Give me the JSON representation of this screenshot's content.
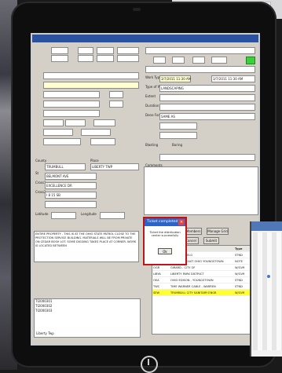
{
  "bg_left": {
    "labels": [
      "x",
      "k",
      "c",
      "e"
    ]
  },
  "tablet": {
    "name": "tablet"
  },
  "app": {
    "header_labels": [
      "Sold To",
      "Phone",
      "Street",
      "Apt",
      "City",
      "State",
      "Zip",
      "Email",
      "Phone",
      "Ext",
      "County",
      "Place",
      "Latitude",
      "Longitude"
    ],
    "header_values": {
      "phone_left": "",
      "county": "TRUMBULL",
      "place": "LIBERTY TWP"
    },
    "address": {
      "label": "St",
      "value": "BELMONT AVE"
    },
    "cross1": {
      "label": "Cross1",
      "value": "EXCELLENCE DR"
    },
    "cross2": {
      "label": "Cross2",
      "value": "I 8 15 SB"
    },
    "right_labels": [
      "Work Type",
      "Type of Work",
      "Extent",
      "Duration",
      "Done For",
      "Blasting",
      "Boring",
      "Work Type",
      "Comments"
    ],
    "right_values": {
      "work_type": "LANDSCAPING",
      "done_for": "SAME AS",
      "start_date": "3/7/2011 11:30 AM",
      "start_date2": "3/7/2011 11:30 AM"
    },
    "notes_text": "ENTIRE PROPERTY - THIS IS AT THE OHIO STATE PATROL CLOSE TO THE PROTECTION SERVICE BUILDING. MATERIALS WILL BE FROM PRIVATE ON CEDAR BOSH LOT. SOME DIGGING TAKES PLACE AT CORNER. WORK IS LOCATED BETWEEN"
  },
  "notes_list": [
    "TI2000301",
    "TI2000302",
    "TI2000303"
  ],
  "bottom_label": "Liberty Twp",
  "buttons": {
    "map": "Map",
    "get_members": "Get Members",
    "manage_grid": "Manage Grid",
    "cancel": "Cancel",
    "submit": "Submit",
    "members": "Members (7)"
  },
  "modal": {
    "title": "Ticket completed",
    "message": "Ticket the distribution center successfully",
    "ok": "Ok"
  },
  "grid": {
    "headers": [
      "Code",
      "Name",
      "Type"
    ],
    "rows": [
      {
        "code": "SBF",
        "name": "AT&T OHIO  ELG",
        "type": "STND"
      },
      {
        "code": "SPC",
        "name": "DOMINION EAST OHIO  YOUNGSTOWN",
        "type": "NOTE"
      },
      {
        "code": "OGR",
        "name": "GIRARD - CITY OF",
        "type": "W/GVR"
      },
      {
        "code": "LIBYA",
        "name": "LIBERTY PARK DISTRICT",
        "type": "W/GVR"
      },
      {
        "code": "OEA",
        "name": "OHIO EDISON - YOUNGSTOWN",
        "type": "STND"
      },
      {
        "code": "TWC",
        "name": "TIME WARNER CABLE - WARREN",
        "type": "STND"
      },
      {
        "code": "SEW",
        "name": "TRUMBULL CITY SANITARY ENGR",
        "type": "W/GVR",
        "highlight": true
      }
    ]
  },
  "colors": {
    "modal_border": "#c0141a",
    "highlight": "#ffff33",
    "title_bar": "#2b63c8",
    "green_flag": "#39d03a"
  }
}
